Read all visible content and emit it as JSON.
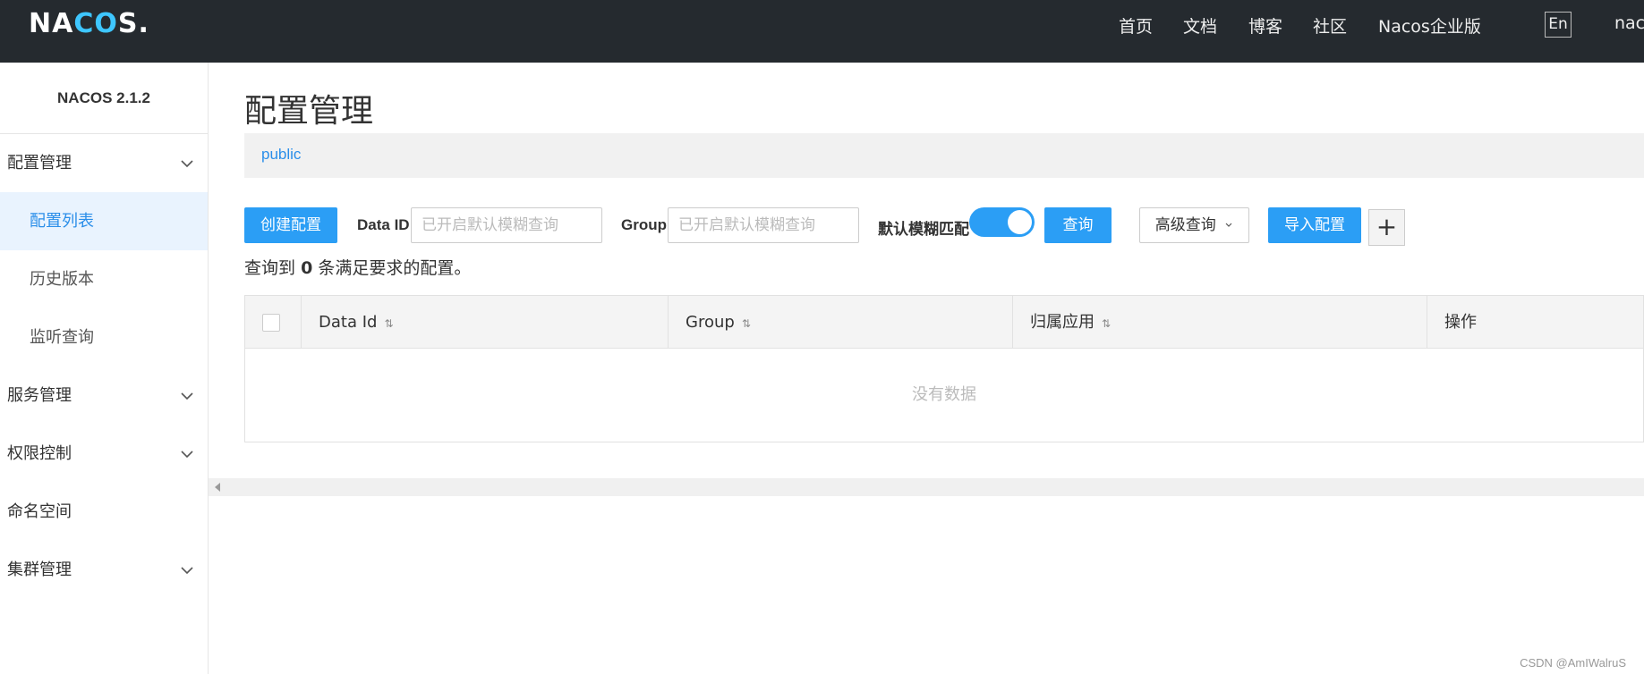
{
  "header": {
    "logo": {
      "prefix": "NA",
      "accent": "CO",
      "suffix": "S.",
      "accent_color": "#3ec6ff"
    },
    "nav": [
      "首页",
      "文档",
      "博客",
      "社区",
      "Nacos企业版"
    ],
    "lang": "En",
    "user_partial": "naco"
  },
  "sidebar": {
    "version": "NACOS 2.1.2",
    "groups": [
      {
        "label": "配置管理",
        "expanded": true,
        "items": [
          {
            "label": "配置列表",
            "active": true
          },
          {
            "label": "历史版本",
            "active": false
          },
          {
            "label": "监听查询",
            "active": false
          }
        ]
      },
      {
        "label": "服务管理",
        "expanded": false
      },
      {
        "label": "权限控制",
        "expanded": false
      },
      {
        "label": "命名空间",
        "expanded": false,
        "no_chevron": true
      },
      {
        "label": "集群管理",
        "expanded": false
      }
    ]
  },
  "main": {
    "title": "配置管理",
    "namespace": "public",
    "toolbar": {
      "create_label": "创建配置",
      "data_id_label": "Data ID",
      "data_id_placeholder": "已开启默认模糊查询",
      "group_label": "Group",
      "group_placeholder": "已开启默认模糊查询",
      "fuzzy_label": "默认模糊匹配",
      "fuzzy_enabled": true,
      "query_label": "查询",
      "advanced_label": "高级查询",
      "import_label": "导入配置",
      "plus_label": "+"
    },
    "result": {
      "prefix": "查询到",
      "count": "0",
      "suffix": "条满足要求的配置。"
    },
    "table": {
      "columns": [
        "Data Id",
        "Group",
        "归属应用",
        "操作"
      ],
      "empty_text": "没有数据"
    }
  },
  "watermark": "CSDN @AmIWalruS",
  "colors": {
    "primary": "#2b9ef5",
    "header_bg": "#252a2f",
    "active_bg": "#e9f3fe"
  }
}
